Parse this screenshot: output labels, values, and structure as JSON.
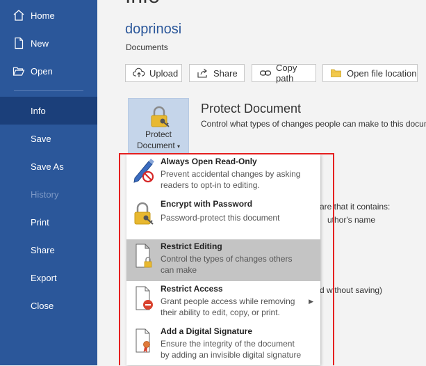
{
  "sidebar": {
    "items": [
      {
        "label": "Home",
        "icon": "home-icon"
      },
      {
        "label": "New",
        "icon": "new-document-icon"
      },
      {
        "label": "Open",
        "icon": "open-folder-icon"
      },
      {
        "label": "Info"
      },
      {
        "label": "Save"
      },
      {
        "label": "Save As"
      },
      {
        "label": "History"
      },
      {
        "label": "Print"
      },
      {
        "label": "Share"
      },
      {
        "label": "Export"
      },
      {
        "label": "Close"
      }
    ]
  },
  "header": {
    "page_title": "Info",
    "site_name": "doprinosi",
    "site_sub": "Documents"
  },
  "actions": {
    "upload": "Upload",
    "share": "Share",
    "copy_path": "Copy path",
    "open_location": "Open file location"
  },
  "protect": {
    "tile_line1": "Protect",
    "tile_line2": "Document",
    "title": "Protect Document",
    "description": "Control what types of changes people can make to this docum"
  },
  "background": {
    "inspect_fragment": "are that it contains:",
    "author_fragment": "uthor's name",
    "versions_fragment": "d without saving)"
  },
  "menu": {
    "items": [
      {
        "title": "Always Open Read-Only",
        "desc1": "Prevent accidental changes by asking",
        "desc2": "readers to opt-in to editing."
      },
      {
        "title": "Encrypt with Password",
        "desc1": "Password-protect this document",
        "desc2": ""
      },
      {
        "title": "Restrict Editing",
        "desc1": "Control the types of changes others",
        "desc2": "can make"
      },
      {
        "title": "Restrict Access",
        "desc1": "Grant people access while removing",
        "desc2": "their ability to edit, copy, or print."
      },
      {
        "title": "Add a Digital Signature",
        "desc1": "Ensure the integrity of the document",
        "desc2": "by adding an invisible digital signature"
      }
    ]
  },
  "colors": {
    "sidebar": "#2b579a",
    "sidebar_active": "#1b3f7a",
    "highlight": "#c4c4c4",
    "annotation": "#e51f1f"
  }
}
